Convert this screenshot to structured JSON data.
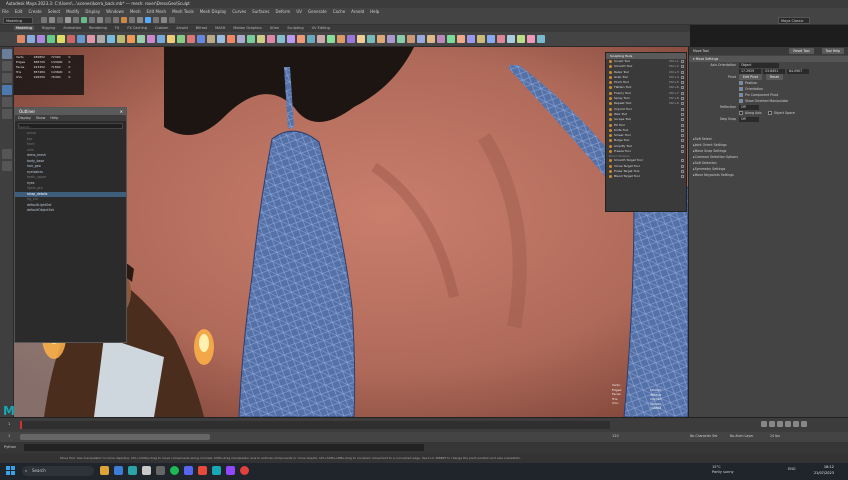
{
  "window": {
    "title": "Autodesk Maya 2023.3: C:\\Users\\...\\scenes\\korra_back.mb* --- mesh: rover\\DressGeo\\Sculpt"
  },
  "menubar": [
    "File",
    "Edit",
    "Create",
    "Select",
    "Modify",
    "Display",
    "Windows",
    "Mesh",
    "Edit Mesh",
    "Mesh Tools",
    "Mesh Display",
    "Curves",
    "Surfaces",
    "Deform",
    "UV",
    "Generate",
    "Cache",
    "Arnold",
    "Help"
  ],
  "statusline": {
    "mode": "Modeling",
    "workspace": "Maya Classic"
  },
  "shelf_tabs": [
    "Modeling",
    "Rigging",
    "Animation",
    "Rendering",
    "FX",
    "FX Caching",
    "Custom",
    "Arnold",
    "Bifrost",
    "MASH",
    "Motion Graphics",
    "XGen",
    "Sculpting",
    "UV Editing"
  ],
  "shelf_tab_active": "Modeling",
  "object_table": {
    "rows": [
      [
        "Verts",
        "186852",
        "72300",
        "0"
      ],
      [
        "Edges",
        "388720",
        "143900",
        "0"
      ],
      [
        "Faces",
        "193452",
        "71800",
        "0"
      ],
      [
        "Tris",
        "387484",
        "143600",
        "0"
      ],
      [
        "UVs",
        "198250",
        "76400",
        "0"
      ]
    ]
  },
  "outliner": {
    "title": "Outliner",
    "menu": [
      "Display",
      "Show",
      "Help"
    ],
    "search_placeholder": "Search...",
    "items": [
      {
        "label": "persp",
        "state": "dim"
      },
      {
        "label": "top",
        "state": "dim"
      },
      {
        "label": "front",
        "state": "dim"
      },
      {
        "label": "side",
        "state": "dim"
      },
      {
        "label": "dress_mesh",
        "state": ""
      },
      {
        "label": "body_base",
        "state": ""
      },
      {
        "label": "hair_geo",
        "state": ""
      },
      {
        "label": "eyelashes",
        "state": ""
      },
      {
        "label": "teeth_upper",
        "state": "dim"
      },
      {
        "label": "eyes",
        "state": ""
      },
      {
        "label": "lights_grp",
        "state": "dim"
      },
      {
        "label": "strap_details",
        "state": "hl"
      },
      {
        "label": "rig_ctrl",
        "state": "dim"
      },
      {
        "label": "defaultLightSet",
        "state": ""
      },
      {
        "label": "defaultObjectSet",
        "state": ""
      }
    ]
  },
  "sculpt_menu": {
    "title": "Sculpting Tools",
    "items": [
      {
        "label": "Sculpt Tool",
        "shortcut": "Ctrl+1"
      },
      {
        "label": "Smooth Tool",
        "shortcut": "Ctrl+2"
      },
      {
        "label": "Relax Tool",
        "shortcut": "Ctrl+3"
      },
      {
        "label": "Grab Tool",
        "shortcut": "Ctrl+4"
      },
      {
        "label": "Pinch Tool",
        "shortcut": "Ctrl+5"
      },
      {
        "label": "Flatten Tool",
        "shortcut": "Ctrl+6"
      },
      {
        "label": "Foamy Tool",
        "shortcut": "Ctrl+7"
      },
      {
        "label": "Spray Tool",
        "shortcut": "Ctrl+8"
      },
      {
        "label": "Repeat Tool",
        "shortcut": "Ctrl+9"
      },
      {
        "label": "Imprint Tool",
        "shortcut": ""
      },
      {
        "label": "Wax Tool",
        "shortcut": ""
      },
      {
        "label": "Scrape Tool",
        "shortcut": ""
      },
      {
        "label": "Fill Tool",
        "shortcut": ""
      },
      {
        "label": "Knife Tool",
        "shortcut": ""
      },
      {
        "label": "Smear Tool",
        "shortcut": ""
      },
      {
        "label": "Bulge Tool",
        "shortcut": ""
      },
      {
        "label": "Amplify Tool",
        "shortcut": ""
      },
      {
        "label": "Freeze Tool",
        "shortcut": ""
      }
    ],
    "section2": "Blend Shapes",
    "items2": [
      {
        "label": "Smooth Target Tool"
      },
      {
        "label": "Clone Target Tool"
      },
      {
        "label": "Erase Target Tool"
      },
      {
        "label": "Blend Target Tool"
      }
    ]
  },
  "tool_panel": {
    "tab": "Move Tool",
    "buttons": [
      "Reset Tool",
      "Tool Help"
    ],
    "section": "Move Settings",
    "axis_orientation_label": "Axis Orientation",
    "axis_orientation_value": "Object",
    "xyz": [
      "17.2929",
      "23.8451",
      "84.0907"
    ],
    "pivot_label": "Pivot",
    "edit_pivot": "Edit Pivot",
    "reset": "Reset",
    "checks": [
      "Position",
      "Orientation",
      "Pin Component Pivot",
      "Show Oriented Manipulator"
    ],
    "reflection_label": "Reflection",
    "reflection_value": "Off",
    "symmetry": [
      "Along Axis",
      "Object Space"
    ],
    "step_snap_label": "Step Snap",
    "step_snap_value": "Off",
    "sections": [
      "Soft Select",
      "Joint Orient Settings",
      "Move Snap Settings",
      "Common Selection Options",
      "Soft Selection",
      "Symmetry Settings",
      "Move Keypoints Settings"
    ]
  },
  "hud": {
    "left": [
      "Verts:",
      "Edges:",
      "Faces:",
      "Tris:",
      "UVs:"
    ],
    "right": [
      "184420",
      "386502",
      "192310",
      "382940",
      "196004"
    ]
  },
  "timeline": {
    "start": "1",
    "end": "120",
    "current": "1"
  },
  "range": {
    "start": "1",
    "end": "120",
    "fps": "24 fps",
    "character": "No Character Set",
    "anim": "No Anim Layer"
  },
  "cmd": {
    "label": "Python"
  },
  "helpline": "Move Tool: Use manipulator to move object(s). Ctrl+middle-drag to move components along normals. Shift+drag manipulator axis to extrude components or clone objects. Ctrl+Shift+LMB+drag to constrain movement to a connected edge. Use D or INSERT to change the pivot position and axis orientation.",
  "taskbar": {
    "search": "Search",
    "weather_temp": "15°C",
    "weather_desc": "Partly sunny",
    "time": "18:12",
    "date": "21/07/2023",
    "lang": "ENG"
  }
}
